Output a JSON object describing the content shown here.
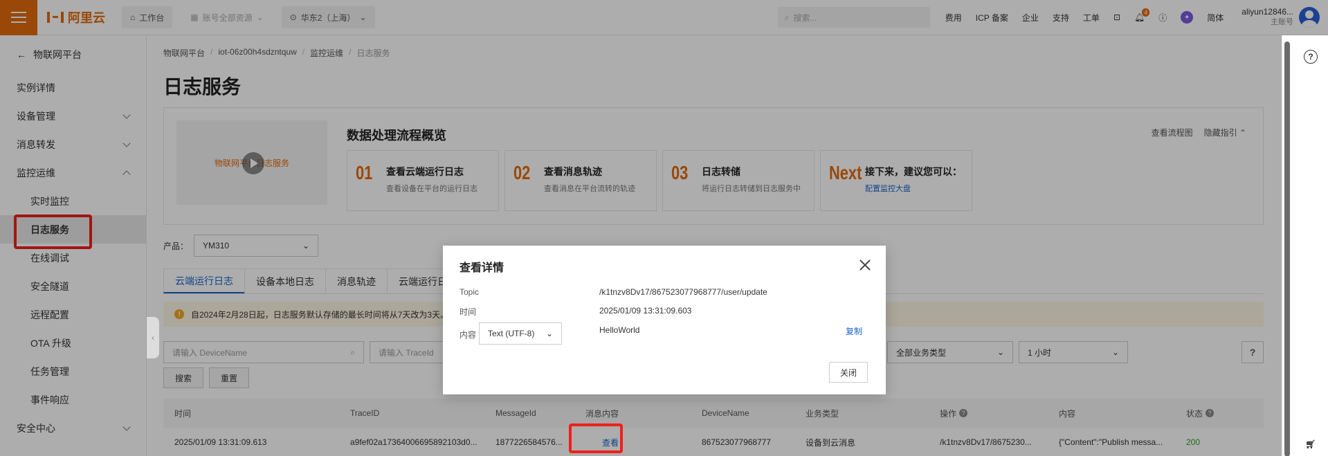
{
  "topbar": {
    "logo_text": "阿里云",
    "workbench": "工作台",
    "account_resources": "账号全部资源",
    "region": "华东2（上海）",
    "search_placeholder": "搜索...",
    "links": [
      "费用",
      "ICP 备案",
      "企业",
      "支持",
      "工单"
    ],
    "bell_badge": "4",
    "language": "简体",
    "user_name": "aliyun12846...",
    "user_role": "主账号"
  },
  "sidebar": {
    "back_label": "物联网平台",
    "items": [
      {
        "label": "实例详情",
        "sub": false,
        "chevron": "none"
      },
      {
        "label": "设备管理",
        "sub": false,
        "chevron": "down"
      },
      {
        "label": "消息转发",
        "sub": false,
        "chevron": "down"
      },
      {
        "label": "监控运维",
        "sub": false,
        "chevron": "up"
      },
      {
        "label": "实时监控",
        "sub": true,
        "chevron": "none"
      },
      {
        "label": "日志服务",
        "sub": true,
        "chevron": "none",
        "active": true
      },
      {
        "label": "在线调试",
        "sub": true,
        "chevron": "none"
      },
      {
        "label": "安全隧道",
        "sub": true,
        "chevron": "none"
      },
      {
        "label": "远程配置",
        "sub": true,
        "chevron": "none"
      },
      {
        "label": "OTA 升级",
        "sub": true,
        "chevron": "none"
      },
      {
        "label": "任务管理",
        "sub": true,
        "chevron": "none"
      },
      {
        "label": "事件响应",
        "sub": true,
        "chevron": "none"
      },
      {
        "label": "安全中心",
        "sub": false,
        "chevron": "down"
      }
    ]
  },
  "breadcrumb": [
    "物联网平台",
    "iot-06z00h4sdzntquw",
    "监控运维",
    "日志服务"
  ],
  "page_title": "日志服务",
  "guide": {
    "video_text": "物联网平台日志服务",
    "title": "数据处理流程概览",
    "link_flow": "查看流程图",
    "link_hide": "隐藏指引",
    "steps": [
      {
        "num": "01",
        "title": "查看云端运行日志",
        "desc": "查看设备在平台的运行日志"
      },
      {
        "num": "02",
        "title": "查看消息轨迹",
        "desc": "查看消息在平台流转的轨迹"
      },
      {
        "num": "03",
        "title": "日志转储",
        "desc": "将运行日志转储到日志服务中"
      },
      {
        "num": "Next",
        "title": "接下来，建议您可以：",
        "link": "配置监控大盘"
      }
    ]
  },
  "product": {
    "label": "产品：",
    "value": "YM310"
  },
  "tabs": [
    "云端运行日志",
    "设备本地日志",
    "消息轨迹",
    "云端运行日"
  ],
  "notice": "自2024年2月28日起，日志服务默认存储的最长时间将从7天改为3天。",
  "filters": {
    "device_placeholder": "请输入 DeviceName",
    "trace_placeholder": "请输入 TraceId",
    "business_type": "全部业务类型",
    "time_range": "1 小时"
  },
  "actions": {
    "search": "搜索",
    "reset": "重置"
  },
  "table": {
    "headers": [
      "时间",
      "TraceID",
      "MessageId",
      "消息内容",
      "DeviceName",
      "业务类型",
      "操作",
      "内容",
      "状态"
    ],
    "row": {
      "time": "2025/01/09 13:31:09.613",
      "trace_id": "a9fef02a17364006695892103d0...",
      "message_id": "1877226584576...",
      "view": "查看",
      "device_name": "867523077968777",
      "business_type": "设备到云消息",
      "operation": "/k1tnzv8Dv17/8675230...",
      "content": "{\"Content\":\"Publish messa...",
      "status": "200"
    }
  },
  "modal": {
    "title": "查看详情",
    "topic_label": "Topic",
    "topic_value": "/k1tnzv8Dv17/867523077968777/user/update",
    "time_label": "时间",
    "time_value": "2025/01/09 13:31:09.603",
    "content_label": "内容",
    "encoding": "Text (UTF-8)",
    "content_value": "HelloWorld",
    "copy": "复制",
    "close": "关闭"
  }
}
